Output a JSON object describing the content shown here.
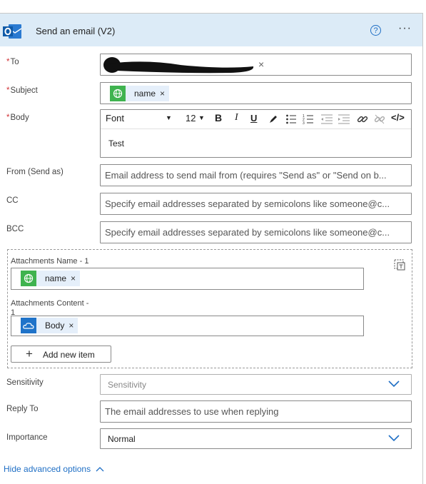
{
  "action": {
    "title": "Send an email (V2)",
    "help_glyph": "?",
    "more_glyph": "···"
  },
  "fields": {
    "to": {
      "label": "To",
      "required_mark": "*",
      "remove_glyph": "×"
    },
    "subject": {
      "label": "Subject",
      "required_mark": "*",
      "token": "name",
      "remove_glyph": "×"
    },
    "body": {
      "label": "Body",
      "required_mark": "*",
      "toolbar": {
        "font": "Font",
        "size": "12",
        "bold": "B",
        "italic": "I",
        "underline": "U"
      },
      "content": "Test"
    },
    "from": {
      "label": "From (Send as)",
      "placeholder": "Email address to send mail from (requires \"Send as\" or \"Send on b..."
    },
    "cc": {
      "label": "CC",
      "placeholder": "Specify email addresses separated by semicolons like someone@c..."
    },
    "bcc": {
      "label": "BCC",
      "placeholder": "Specify email addresses separated by semicolons like someone@c..."
    },
    "attachments": {
      "name_label": "Attachments Name - 1",
      "name_token": "name",
      "content_label_line1": "Attachments Content -",
      "content_label_line2": "1",
      "content_token": "Body",
      "remove_glyph": "×",
      "add_item_label": "Add new item",
      "add_glyph": "+"
    },
    "sensitivity": {
      "label": "Sensitivity",
      "placeholder": "Sensitivity"
    },
    "reply_to": {
      "label": "Reply To",
      "placeholder": "The email addresses to use when replying"
    },
    "importance": {
      "label": "Importance",
      "value": "Normal"
    }
  },
  "footer": {
    "hide_advanced": "Hide advanced options"
  },
  "colors": {
    "header_bg": "#dcebf7",
    "accent": "#1f6fc5",
    "required": "#d13438",
    "token_bg": "#e5effa",
    "green_icon": "#3fb34f",
    "onedrive_icon": "#1f73c9"
  }
}
